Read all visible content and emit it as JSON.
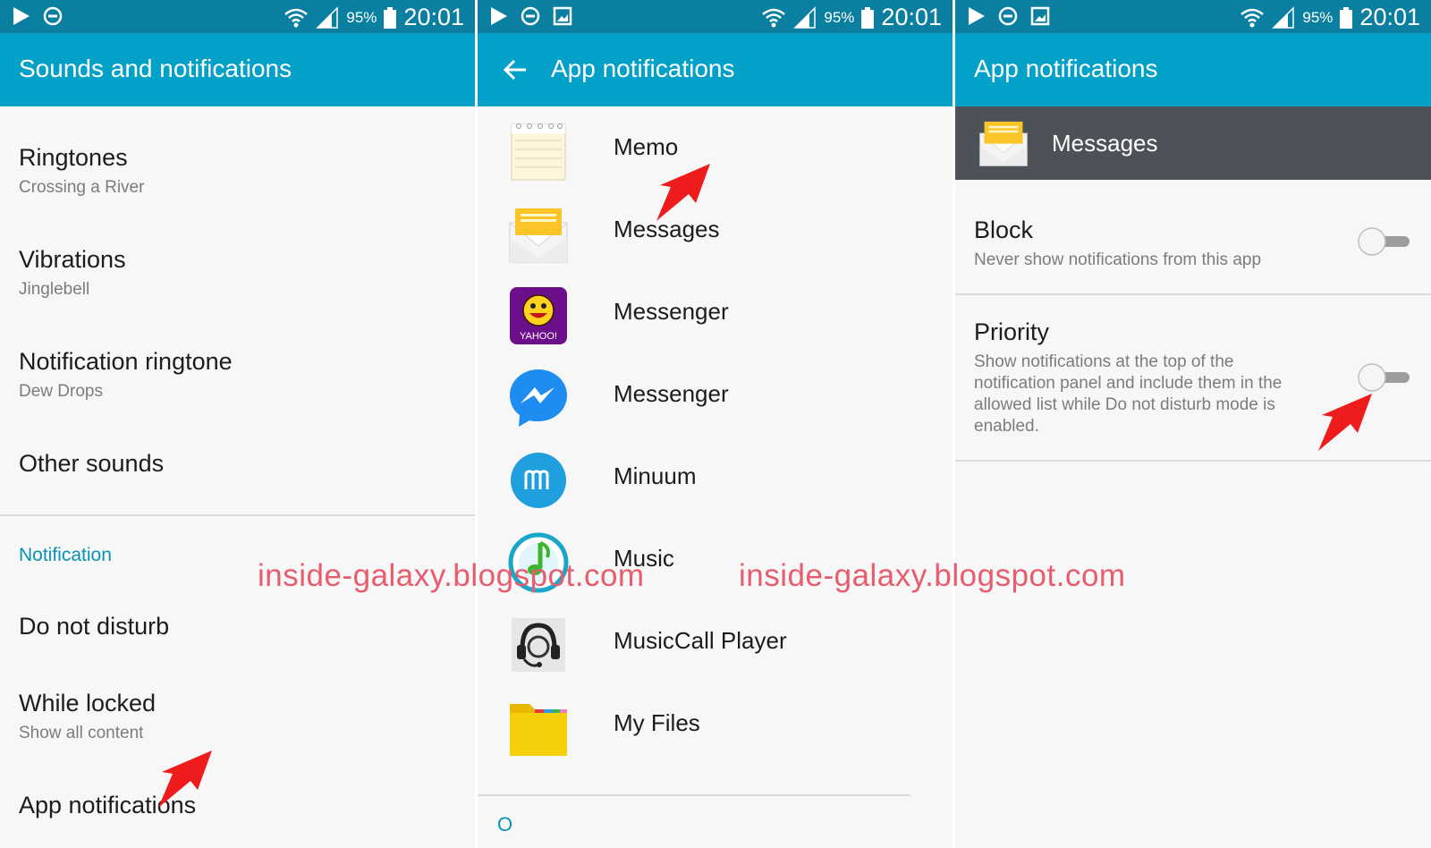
{
  "status": {
    "percent": "95%",
    "time": "20:01"
  },
  "panel1": {
    "title": "Sounds and notifications",
    "items": [
      {
        "title": "Ringtones",
        "subtitle": "Crossing a River"
      },
      {
        "title": "Vibrations",
        "subtitle": "Jinglebell"
      },
      {
        "title": "Notification ringtone",
        "subtitle": "Dew Drops"
      },
      {
        "title": "Other sounds"
      }
    ],
    "section": "Notification",
    "items2": [
      {
        "title": "Do not disturb"
      },
      {
        "title": "While locked",
        "subtitle": "Show all content"
      },
      {
        "title": "App notifications"
      }
    ]
  },
  "panel2": {
    "title": "App notifications",
    "apps": [
      {
        "name": "Memo",
        "icon": "memo-icon"
      },
      {
        "name": "Messages",
        "icon": "messages-icon"
      },
      {
        "name": "Messenger",
        "icon": "yahoo-messenger-icon"
      },
      {
        "name": "Messenger",
        "icon": "facebook-messenger-icon"
      },
      {
        "name": "Minuum",
        "icon": "minuum-icon"
      },
      {
        "name": "Music",
        "icon": "music-icon"
      },
      {
        "name": "MusicCall Player",
        "icon": "musiccall-player-icon"
      },
      {
        "name": "My Files",
        "icon": "my-files-icon"
      }
    ],
    "index_letter": "O"
  },
  "panel3": {
    "title": "App notifications",
    "app_name": "Messages",
    "block": {
      "title": "Block",
      "subtitle": "Never show notifications from this app",
      "enabled": false
    },
    "priority": {
      "title": "Priority",
      "subtitle_lines": [
        "Show notifications at the top of the",
        "notification panel and include them in the",
        "allowed list while Do not disturb mode is",
        "enabled."
      ],
      "enabled": false
    }
  },
  "watermark": {
    "left": "inside-galaxy.blogspot.com",
    "right": "inside-galaxy.blogspot.com"
  },
  "colors": {
    "status_bar": "#0a7fa0",
    "app_bar": "#03a0c7",
    "accent": "#0a92b6",
    "arrow": "#ee1c1c"
  }
}
